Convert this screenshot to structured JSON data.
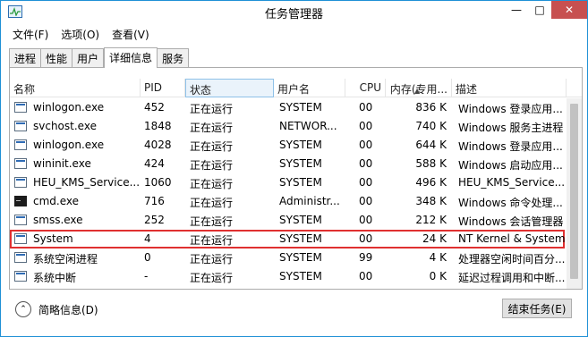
{
  "window": {
    "title": "任务管理器"
  },
  "menu": [
    "文件(F)",
    "选项(O)",
    "查看(V)"
  ],
  "tabs": [
    "进程",
    "性能",
    "用户",
    "详细信息",
    "服务"
  ],
  "active_tab": "详细信息",
  "columns": {
    "name": "名称",
    "pid": "PID",
    "status": "状态",
    "user": "用户名",
    "cpu": "CPU",
    "mem": "内存(专用...",
    "desc": "描述"
  },
  "rows": [
    {
      "icon": "window-icon",
      "name": "winlogon.exe",
      "pid": "452",
      "status": "正在运行",
      "user": "SYSTEM",
      "cpu": "00",
      "mem": "836 K",
      "desc": "Windows 登录应用..."
    },
    {
      "icon": "window-icon",
      "name": "svchost.exe",
      "pid": "1848",
      "status": "正在运行",
      "user": "NETWOR...",
      "cpu": "00",
      "mem": "740 K",
      "desc": "Windows 服务主进程"
    },
    {
      "icon": "window-icon",
      "name": "winlogon.exe",
      "pid": "4028",
      "status": "正在运行",
      "user": "SYSTEM",
      "cpu": "00",
      "mem": "644 K",
      "desc": "Windows 登录应用..."
    },
    {
      "icon": "window-icon",
      "name": "wininit.exe",
      "pid": "424",
      "status": "正在运行",
      "user": "SYSTEM",
      "cpu": "00",
      "mem": "588 K",
      "desc": "Windows 启动应用..."
    },
    {
      "icon": "window-icon",
      "name": "HEU_KMS_Service...",
      "pid": "1060",
      "status": "正在运行",
      "user": "SYSTEM",
      "cpu": "00",
      "mem": "496 K",
      "desc": "HEU_KMS_Service..."
    },
    {
      "icon": "cmd-icon",
      "name": "cmd.exe",
      "pid": "716",
      "status": "正在运行",
      "user": "Administr...",
      "cpu": "00",
      "mem": "348 K",
      "desc": "Windows 命令处理..."
    },
    {
      "icon": "window-icon",
      "name": "smss.exe",
      "pid": "252",
      "status": "正在运行",
      "user": "SYSTEM",
      "cpu": "00",
      "mem": "212 K",
      "desc": "Windows 会话管理器"
    },
    {
      "icon": "window-icon",
      "name": "System",
      "pid": "4",
      "status": "正在运行",
      "user": "SYSTEM",
      "cpu": "00",
      "mem": "24 K",
      "desc": "NT Kernel & System"
    },
    {
      "icon": "window-icon",
      "name": "系统空闲进程",
      "pid": "0",
      "status": "正在运行",
      "user": "SYSTEM",
      "cpu": "99",
      "mem": "4 K",
      "desc": "处理器空闲时间百分..."
    },
    {
      "icon": "window-icon",
      "name": "系统中断",
      "pid": "-",
      "status": "正在运行",
      "user": "SYSTEM",
      "cpu": "00",
      "mem": "0 K",
      "desc": "延迟过程调用和中断..."
    }
  ],
  "highlighted_row": "System",
  "footer": {
    "fewer_details": "简略信息(D)",
    "end_task": "结束任务(E)"
  },
  "colors": {
    "highlight_outline": "#e03030",
    "close_button": "#c75050",
    "window_border": "#1e90d6"
  }
}
